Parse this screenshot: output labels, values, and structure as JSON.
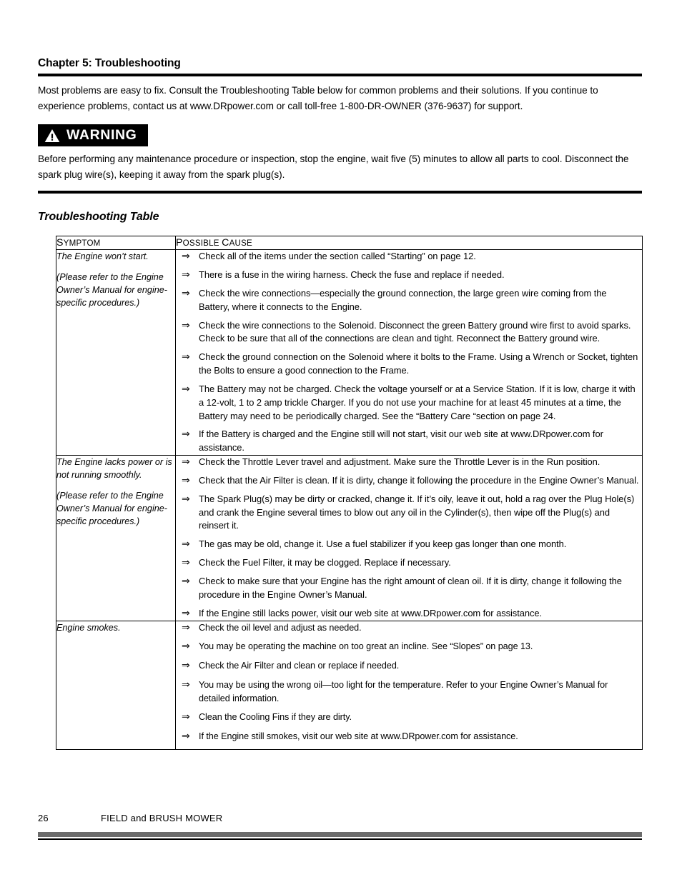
{
  "document": {
    "chapter_title": "Chapter 5: Troubleshooting",
    "intro": "Most problems are easy to fix. Consult the Troubleshooting Table below for common problems and their solutions. If you continue to experience problems, contact us at www.DRpower.com or call toll-free 1-800-DR-OWNER (376-9637) for support.",
    "section_heading": "Troubleshooting Table"
  },
  "warning": {
    "label": "WARNING",
    "icon": "warning-triangle-icon",
    "text": "Before performing any maintenance procedure or inspection, stop the engine, wait five (5) minutes to allow all parts to cool. Disconnect the spark plug wire(s), keeping it away from the spark plug(s)."
  },
  "table": {
    "headers": {
      "symptom_cap": "S",
      "symptom_rest": "YMPTOM",
      "cause_cap1": "P",
      "cause_rest1": "OSSIBLE ",
      "cause_cap2": "C",
      "cause_rest2": "AUSE"
    },
    "bullet_glyph": "⇒",
    "rows": [
      {
        "symptom_lines": [
          "The Engine won’t start.",
          "(Please refer to the Engine Owner’s Manual for engine-specific procedures.)"
        ],
        "causes": [
          "Check all of the items under the section called “Starting” on page 12.",
          "There is a fuse in the wiring harness.  Check the fuse and replace if needed.",
          "Check the wire connections—especially the ground connection, the large green wire coming from the Battery, where it connects to the Engine.",
          "Check the wire connections to the Solenoid.  Disconnect the green Battery ground wire first to avoid sparks.  Check to be sure that all of the connections are clean and tight.  Reconnect the Battery ground wire.",
          "Check the ground connection on the Solenoid where it bolts to the Frame.  Using a Wrench or Socket, tighten the Bolts to ensure a good connection to the Frame.",
          "The Battery may not be charged.  Check the voltage yourself or at a Service Station.  If it is low, charge it with a 12-volt, 1 to 2 amp trickle Charger.  If you do not use your machine for at least 45 minutes at a time, the Battery may need to be periodically charged.  See the “Battery Care “section on page 24.",
          "If the Battery is charged and the Engine still will not start, visit our web site at www.DRpower.com for assistance."
        ]
      },
      {
        "symptom_lines": [
          "The Engine lacks power or is not running smoothly.",
          "(Please refer to the Engine Owner’s Manual for engine-specific procedures.)"
        ],
        "causes": [
          "Check the Throttle Lever travel and adjustment.  Make sure the Throttle Lever is in the Run position.",
          "Check that the Air Filter is clean.  If it is dirty, change it following the procedure in the Engine Owner’s Manual.",
          "The Spark Plug(s) may be dirty or cracked, change it.  If it’s oily, leave it out, hold a rag over the Plug Hole(s) and crank the Engine several times to blow out any oil in the Cylinder(s), then wipe off the Plug(s) and reinsert it.",
          "The gas may be old, change it.  Use a fuel stabilizer if you keep gas longer than one month.",
          "Check the Fuel Filter, it may be clogged.  Replace if necessary.",
          "Check to make sure that your Engine has the right amount of clean oil.  If it is dirty, change it following the procedure in the Engine Owner’s Manual.",
          "If the Engine still lacks power, visit our web site at www.DRpower.com for assistance."
        ]
      },
      {
        "symptom_lines": [
          "Engine smokes."
        ],
        "causes": [
          "Check the oil level and adjust as needed.",
          "You may be operating the machine on too great an incline.  See “Slopes” on page 13.",
          "Check the Air Filter and clean or replace if needed.",
          "You may be using the wrong oil—too light for the temperature.  Refer to your Engine Owner’s Manual for detailed information.",
          "Clean the Cooling Fins if they are dirty.",
          "If the Engine still smokes, visit our web site at www.DRpower.com for assistance."
        ]
      }
    ]
  },
  "footer": {
    "page_number": "26",
    "product_name": "FIELD and BRUSH MOWER"
  }
}
